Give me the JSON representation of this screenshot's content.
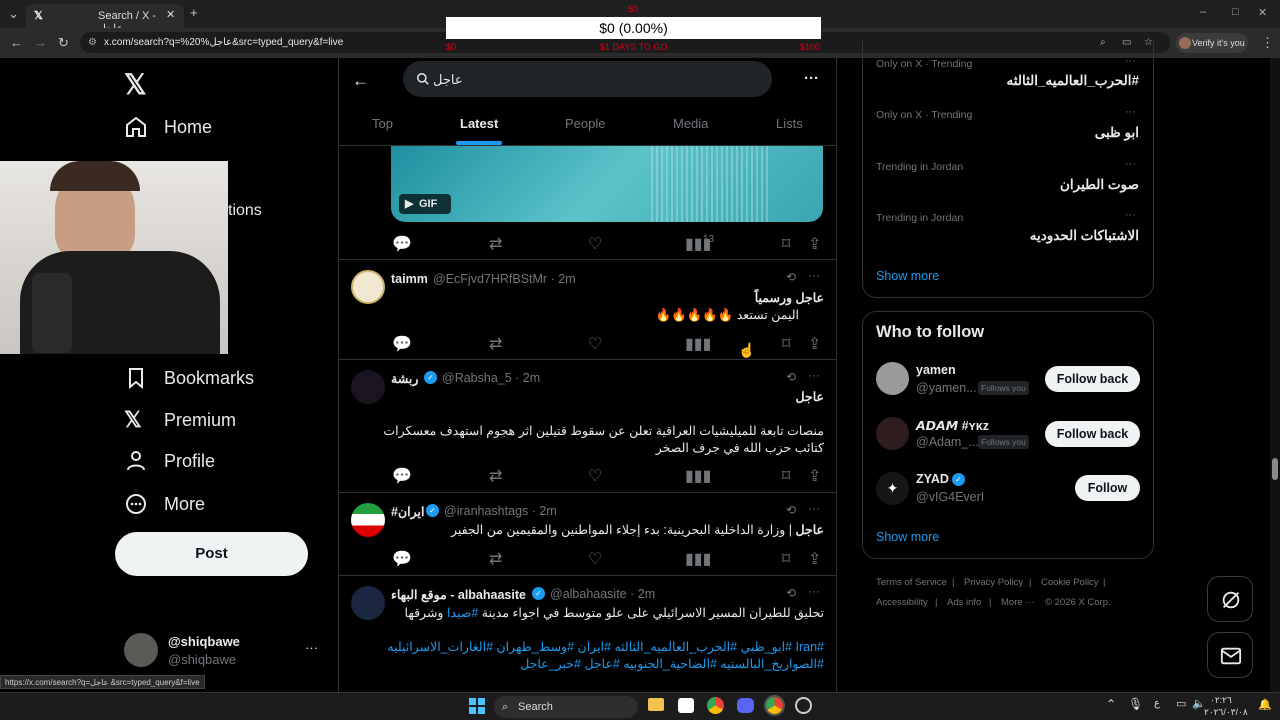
{
  "browser": {
    "tab_title": "Search / X - عاجل",
    "url": "x.com/search?q=%20%عاجل&src=typed_query&f=live",
    "verify_label": "Verify it's you",
    "status_url": "https://x.com/search?q=عاجل &src=typed_query&f=live"
  },
  "overlay": {
    "amount": "$0 (0.00%)",
    "left_label": "$0",
    "mid_label": "$1 DAYS TO GO",
    "right_label": "$100",
    "top_mark": "$0"
  },
  "sidebar": {
    "home": "Home",
    "notifications_partial": "tions",
    "bookmarks": "Bookmarks",
    "premium": "Premium",
    "profile": "Profile",
    "more": "More",
    "post": "Post",
    "account_name": "@shiqbawe",
    "account_handle": "@shiqbawe"
  },
  "search": {
    "query": "عاجل",
    "tabs": [
      "Top",
      "Latest",
      "People",
      "Media",
      "Lists"
    ],
    "active_tab": "Latest"
  },
  "tweets": [
    {
      "gif_label": "GIF",
      "views": "13"
    },
    {
      "name": "taimm",
      "handle": "@EcFjvd7HRfBStMr · 2m",
      "line1": "عاجل ورسمياً",
      "line2": "اليمن تستعد 🔥🔥🔥🔥🔥"
    },
    {
      "name": "ربشة",
      "handle": "@Rabsha_5 · 2m",
      "line1": "عاجل",
      "line2": "منصات تابعة للميليشيات العراقية تعلن عن سقوط قتيلين اثر هجوم استهدف معسكرات",
      "line3": "كتائب حزب الله في جرف الصخر"
    },
    {
      "name": "#ايران",
      "handle": "@iranhashtags · 2m",
      "line1_bold": "عاجل",
      "line1": " | وزارة الداخلية البحرينية: بدء إجلاء المواطنين والمقيمين من الجفير"
    },
    {
      "name": "موقع البهاء - albahaasite",
      "handle": "@albahaasite · 2m",
      "line1": "تحليق للطيران المسير الاسرائيلي على علو متوسط في اجواء مدينة ",
      "line1_tag": "#صيدا",
      "line1_end": " وشرقها",
      "tags1": "#Iran #ابو_ظبي #الحرب_العالميه_الثالثه #ايران #وسط_طهران #الغارات_الاسرائيليه",
      "tags2": "#الصواريخ_البالستيه #الضاحية_الجنوبيه #عاجل #خبر_عاجل"
    }
  ],
  "trends": [
    {
      "label": "Only on X · Trending",
      "title": "#الحرب_العالميه_الثالثه"
    },
    {
      "label": "Only on X · Trending",
      "title": "ابو ظبى"
    },
    {
      "label": "Trending in Jordan",
      "title": "صوت الطيران"
    },
    {
      "label": "Trending in Jordan",
      "title": "الاشتباكات الحدوديه"
    }
  ],
  "show_more": "Show more",
  "who_to_follow": {
    "title": "Who to follow",
    "users": [
      {
        "name": "yamen",
        "handle": "@yamen...",
        "badge": "Follows you",
        "button": "Follow back"
      },
      {
        "name": "𝘼𝘿𝘼𝙈 #ʏᴋᴢ",
        "handle": "@Adam_...",
        "badge": "Follows you",
        "button": "Follow back"
      },
      {
        "name": "ZYAD",
        "handle": "@vIG4EverI",
        "badge": "",
        "button": "Follow"
      }
    ]
  },
  "footer": {
    "terms": "Terms of Service",
    "privacy": "Privacy Policy",
    "cookie": "Cookie Policy",
    "accessibility": "Accessibility",
    "ads": "Ads info",
    "more": "More ···",
    "copyright": "© 2026 X Corp."
  },
  "taskbar": {
    "search": "Search",
    "time": "٠٢:٢٦",
    "date": "٢٠٢٦/٠٣/٠٨"
  }
}
